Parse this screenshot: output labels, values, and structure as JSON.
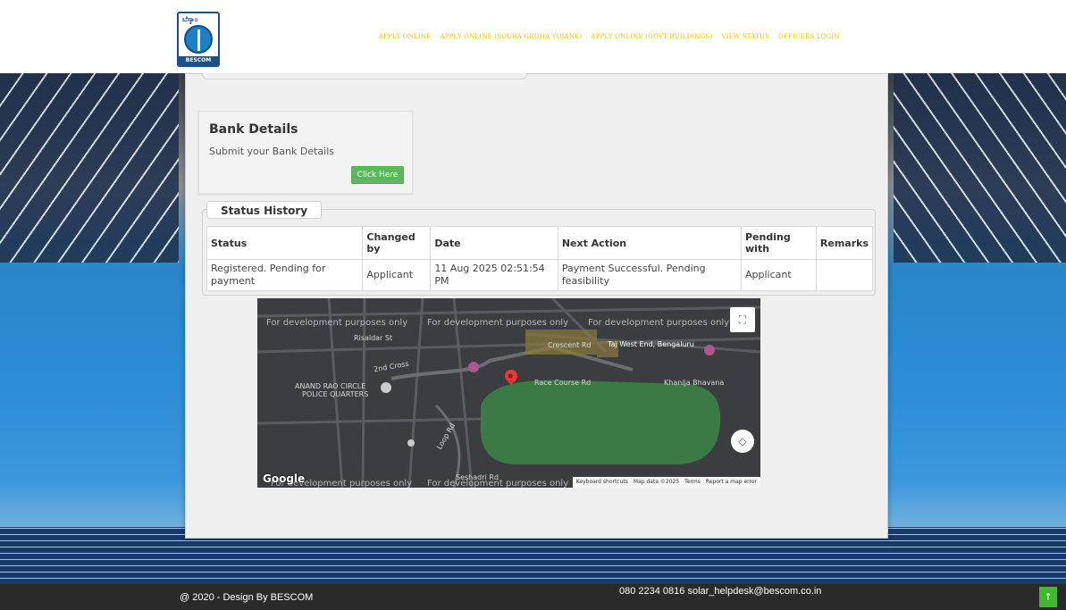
{
  "header": {
    "logo_kannada": "ಬೆಸ್ಕಾಂ",
    "logo_text": "BESCOM",
    "nav": [
      {
        "label": "APPLY ONLINE"
      },
      {
        "label": "APPLY ONLINE (SOURA GRUHA YOJANE)"
      },
      {
        "label": "APPLY ONLINE (GOVT BUILDINGS)"
      },
      {
        "label": "VIEW STATUS"
      },
      {
        "label": "OFFICERS LOGIN"
      }
    ]
  },
  "bank_card": {
    "title": "Bank Details",
    "description": "Submit your Bank Details",
    "button_label": "Click Here"
  },
  "status_history": {
    "legend": "Status History",
    "columns": [
      "Status",
      "Changed by",
      "Date",
      "Next Action",
      "Pending with",
      "Remarks"
    ],
    "rows": [
      {
        "status": "Registered. Pending for payment",
        "changed_by": "Applicant",
        "date": "11 Aug 2025 02:51:54 PM",
        "next_action": "Payment Successful. Pending feasibility",
        "pending_with": "Applicant",
        "remarks": ""
      }
    ]
  },
  "map": {
    "dev_text": "For development purposes only",
    "labels": {
      "risaldar": "Risaldar St",
      "crescent": "Crescent Rd",
      "tajwest": "Taj West End, Bengaluru",
      "race": "Race Course Rd",
      "khanija": "Khanija Bhavana",
      "anand": "ANAND RAO CIRCLE",
      "police": "POLICE QUARTERS",
      "seshadri": "Seshadri Rd",
      "loop": "Loop Rd",
      "cross2": "2nd Cross"
    },
    "attribution": [
      "Keyboard shortcuts",
      "Map data ©2025",
      "Terms",
      "Report a map error"
    ],
    "google": "Google"
  },
  "footer": {
    "copyright": "@ 2020 - Design By BESCOM",
    "contact": "080 2234 0816   solar_helpdesk@bescom.co.in",
    "to_top": "↑"
  }
}
